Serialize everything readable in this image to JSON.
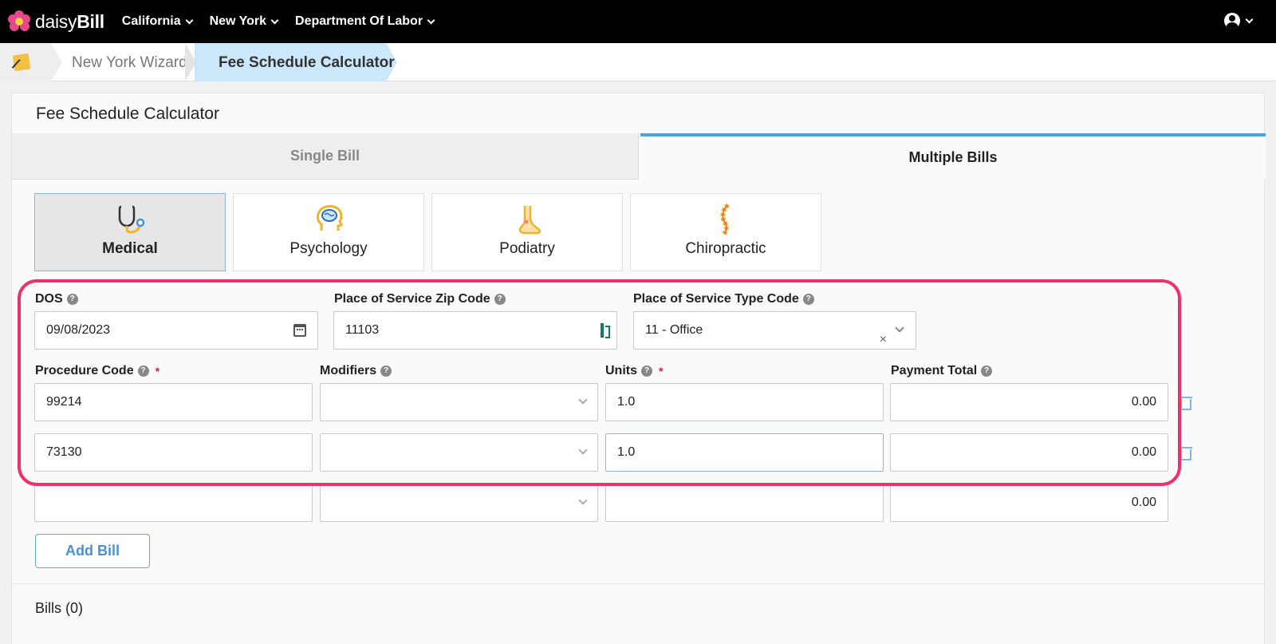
{
  "brand": {
    "name_light": "daisy",
    "name_bold": "Bill"
  },
  "nav": {
    "items": [
      "California",
      "New York",
      "Department Of Labor"
    ]
  },
  "breadcrumb": {
    "wizard": "New York Wizard",
    "current": "Fee Schedule Calculator"
  },
  "card": {
    "title": "Fee Schedule Calculator"
  },
  "tabs": {
    "single": "Single Bill",
    "multiple": "Multiple Bills",
    "active": "Multiple Bills"
  },
  "specialties": [
    "Medical",
    "Psychology",
    "Podiatry",
    "Chiropractic"
  ],
  "specialty_active": "Medical",
  "form": {
    "dos_label": "DOS",
    "dos_value": "09/08/2023",
    "zip_label": "Place of Service Zip Code",
    "zip_value": "11103",
    "pos_type_label": "Place of Service Type Code",
    "pos_type_value": "11 - Office",
    "procedure_label": "Procedure Code",
    "modifiers_label": "Modifiers",
    "units_label": "Units",
    "payment_label": "Payment Total",
    "required_mark": "*",
    "help_mark": "?",
    "clear_mark": "×"
  },
  "rows": [
    {
      "procedure": "99214",
      "modifiers": "",
      "units": "1.0",
      "payment": "0.00"
    },
    {
      "procedure": "73130",
      "modifiers": "",
      "units": "1.0",
      "payment": "0.00"
    },
    {
      "procedure": "",
      "modifiers": "",
      "units": "",
      "payment": "0.00"
    }
  ],
  "buttons": {
    "add_bill": "Add Bill"
  },
  "bills": {
    "count_label": "Bills (0)"
  },
  "colors": {
    "highlight": "#f0306b",
    "accent": "#4aa3df",
    "breadcrumb_active": "#cbe7fa"
  }
}
